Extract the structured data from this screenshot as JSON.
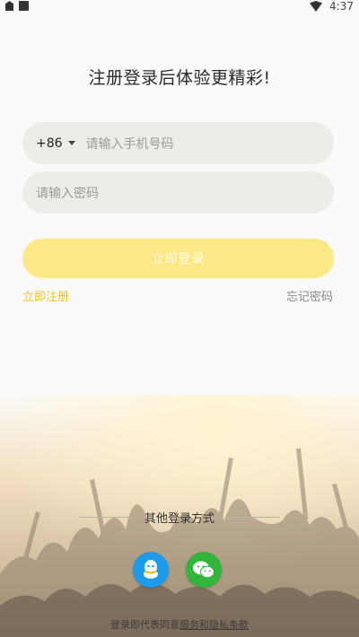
{
  "status_bar": {
    "time": "4:37"
  },
  "title": "注册登录后体验更精彩!",
  "phone": {
    "country_code": "+86",
    "placeholder": "请输入手机号码"
  },
  "password": {
    "placeholder": "请输入密码"
  },
  "login_button": "立即登录",
  "register_link": "立即注册",
  "forgot_link": "忘记密码",
  "other_login": "其他登录方式",
  "social": [
    {
      "icon": "qq-icon"
    },
    {
      "icon": "wechat-icon"
    }
  ],
  "agreement": {
    "prefix": "登录即代表同意",
    "link": "服务和隐私条款"
  },
  "colors": {
    "accent": "#fde887",
    "link": "#f2c41c",
    "qq": "#1d9be9",
    "wechat": "#31b53a"
  }
}
